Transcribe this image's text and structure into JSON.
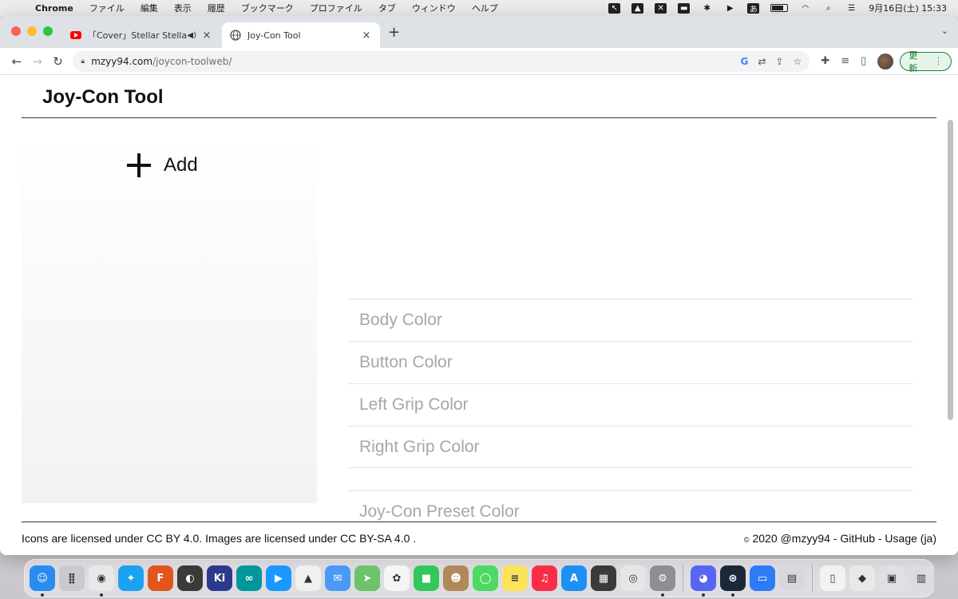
{
  "menubar": {
    "app_name": "Chrome",
    "items": [
      "ファイル",
      "編集",
      "表示",
      "履歴",
      "ブックマーク",
      "プロファイル",
      "タブ",
      "ウィンドウ",
      "ヘルプ"
    ],
    "clock": "9月16日(土) 15:33",
    "ime_label": "あ"
  },
  "browser": {
    "tabs": [
      {
        "title": "「Cover」Stellar Stellar - N",
        "favicon": "youtube-icon",
        "active": false
      },
      {
        "title": "Joy-Con Tool",
        "favicon": "globe-icon",
        "active": true
      }
    ],
    "new_tab": "+",
    "url_host": "mzyy94.com",
    "url_path": "/joycon-toolweb/",
    "update_label": "更新"
  },
  "page": {
    "title": "Joy-Con Tool",
    "add_label": "Add",
    "color_options": [
      "Body Color",
      "Button Color",
      "Left Grip Color",
      "Right Grip Color"
    ],
    "preset_label": "Joy-Con Preset Color",
    "footer_left": "Icons are licensed under CC BY 4.0. Images are licensed under CC BY-SA 4.0 .",
    "footer_right": "2020 @mzyy94 - GitHub - Usage (ja)",
    "copyright_symbol": "©"
  },
  "dock": {
    "apps": [
      {
        "name": "finder",
        "color": "#2a8cf0",
        "glyph": "☺"
      },
      {
        "name": "launchpad",
        "color": "#c9c9d0",
        "glyph": "⣿"
      },
      {
        "name": "chrome",
        "color": "#e8e8e8",
        "glyph": "◉"
      },
      {
        "name": "twitter",
        "color": "#1da1f2",
        "glyph": "✦"
      },
      {
        "name": "fusion-360",
        "color": "#e2561e",
        "glyph": "F"
      },
      {
        "name": "affinity",
        "color": "#3a3a3a",
        "glyph": "◐"
      },
      {
        "name": "kicad",
        "color": "#2b3a8c",
        "glyph": "Ki"
      },
      {
        "name": "arduino",
        "color": "#00979c",
        "glyph": "∞"
      },
      {
        "name": "prime-video",
        "color": "#1a98ff",
        "glyph": "▶"
      },
      {
        "name": "inkscape",
        "color": "#f0f0f0",
        "glyph": "▲"
      },
      {
        "name": "mail",
        "color": "#4a9af5",
        "glyph": "✉"
      },
      {
        "name": "maps",
        "color": "#6cc36a",
        "glyph": "➤"
      },
      {
        "name": "photos",
        "color": "#f5f5f5",
        "glyph": "✿"
      },
      {
        "name": "facetime",
        "color": "#34c759",
        "glyph": "■"
      },
      {
        "name": "contacts",
        "color": "#b08a5a",
        "glyph": "☻"
      },
      {
        "name": "messages",
        "color": "#4cd964",
        "glyph": "◯"
      },
      {
        "name": "notes",
        "color": "#fbe35a",
        "glyph": "≡"
      },
      {
        "name": "music",
        "color": "#fa2d48",
        "glyph": "♫"
      },
      {
        "name": "app-store",
        "color": "#1e8ff5",
        "glyph": "A"
      },
      {
        "name": "calculator",
        "color": "#3a3a3a",
        "glyph": "▦"
      },
      {
        "name": "screenshot",
        "color": "#e6e6e6",
        "glyph": "◎"
      },
      {
        "name": "system-settings",
        "color": "#8e8e93",
        "glyph": "⚙"
      },
      {
        "name": "discord",
        "color": "#5865f2",
        "glyph": "◕"
      },
      {
        "name": "steam",
        "color": "#1b2838",
        "glyph": "⊛"
      },
      {
        "name": "keynote",
        "color": "#2d7cf6",
        "glyph": "▭"
      },
      {
        "name": "preview",
        "color": "#d8d8dc",
        "glyph": "▤"
      },
      {
        "name": "document-file",
        "color": "#f2f2f2",
        "glyph": "▯"
      },
      {
        "name": "installer",
        "color": "#e8e8e8",
        "glyph": "◆"
      },
      {
        "name": "downloads",
        "color": "#e0e0e4",
        "glyph": "▣"
      },
      {
        "name": "trash",
        "color": "#dcdce0",
        "glyph": "▥"
      }
    ]
  }
}
